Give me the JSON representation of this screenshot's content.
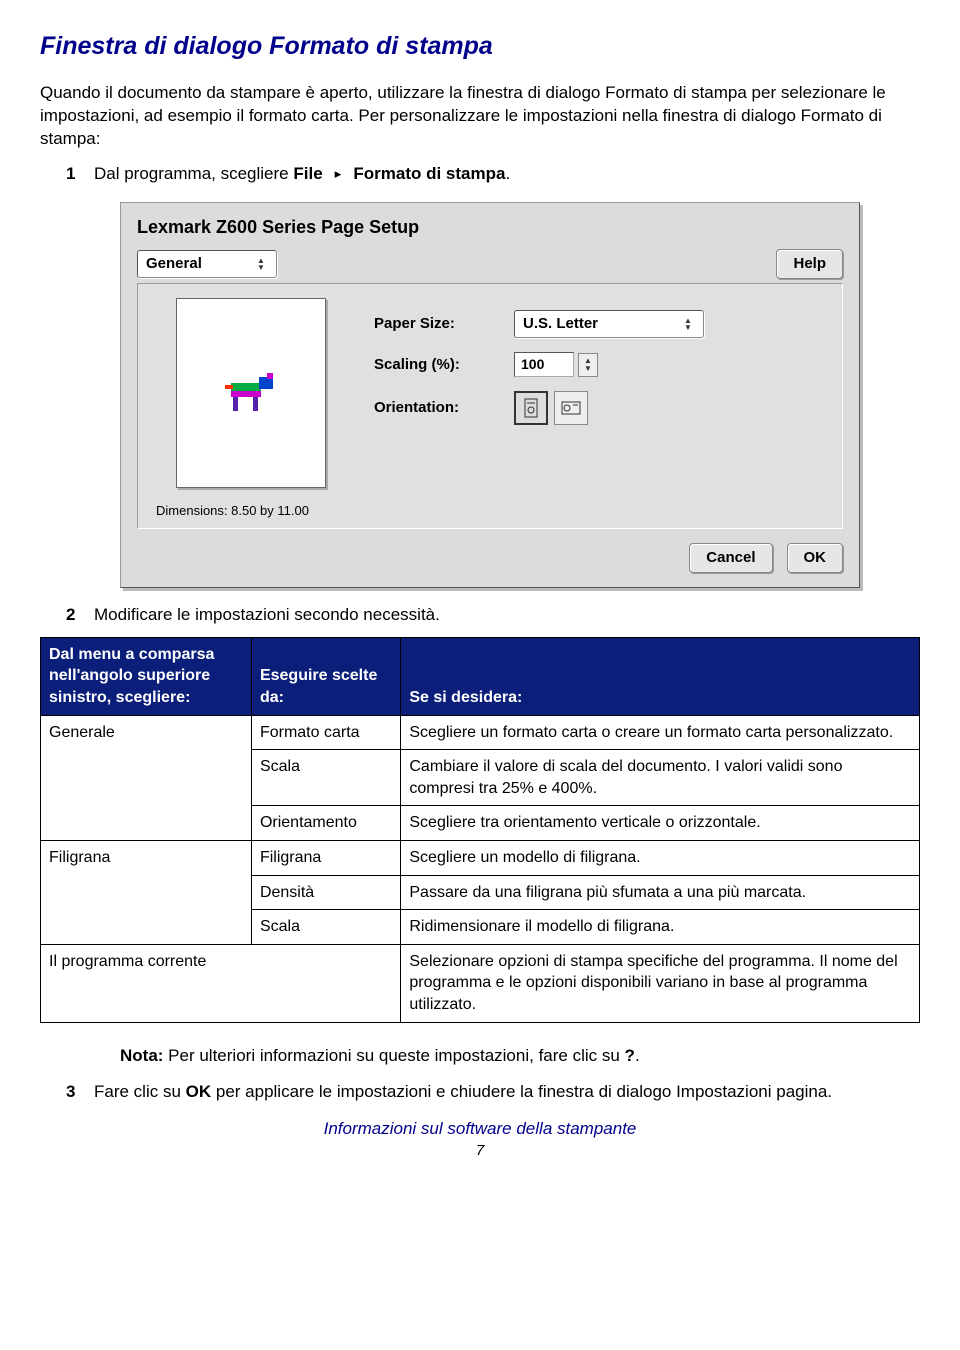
{
  "heading": "Finestra di dialogo Formato di stampa",
  "intro": "Quando il documento da stampare è aperto, utilizzare la finestra di dialogo Formato di stampa per selezionare le impostazioni, ad esempio il formato carta. Per personalizzare le impostazioni nella finestra di dialogo Formato di stampa:",
  "steps": {
    "s1_num": "1",
    "s1_pre": "Dal programma, scegliere ",
    "s1_b1": "File",
    "s1_arrow": " ▸ ",
    "s1_b2": "Formato di stampa",
    "s1_suffix": ".",
    "s2_num": "2",
    "s2_text": "Modificare le impostazioni secondo necessità.",
    "s3_num": "3",
    "s3_pre": "Fare clic su ",
    "s3_b1": "OK",
    "s3_suffix": " per applicare le impostazioni e chiudere la finestra di dialogo Impostazioni pagina."
  },
  "dialog": {
    "title": "Lexmark Z600 Series Page Setup",
    "general": "General",
    "help": "Help",
    "paper_size_label": "Paper Size:",
    "paper_size_value": "U.S. Letter",
    "scaling_label": "Scaling (%):",
    "scaling_value": "100",
    "orientation_label": "Orientation:",
    "dimensions": "Dimensions: 8.50 by 11.00",
    "cancel": "Cancel",
    "ok": "OK"
  },
  "table": {
    "h1": "Dal menu a comparsa nell'angolo superiore sinistro, scegliere:",
    "h2": "Eseguire scelte da:",
    "h3": "Se si desidera:",
    "r1c1": "Generale",
    "r1c2": "Formato carta",
    "r1c3": "Scegliere un formato carta o creare un formato carta personalizzato.",
    "r2c2": "Scala",
    "r2c3": "Cambiare il valore di scala del documento. I valori validi sono compresi tra 25% e 400%.",
    "r3c2": "Orientamento",
    "r3c3": "Scegliere tra orientamento verticale o orizzontale.",
    "r4c1": "Filigrana",
    "r4c2": "Filigrana",
    "r4c3": "Scegliere un modello di filigrana.",
    "r5c2": "Densità",
    "r5c3": "Passare da una filigrana più sfumata a una più marcata.",
    "r6c2": "Scala",
    "r6c3": "Ridimensionare il modello di filigrana.",
    "r7c1": "Il programma corrente",
    "r7c3": "Selezionare opzioni di stampa specifiche del programma. Il nome del programma e le opzioni disponibili variano in base al programma utilizzato."
  },
  "note": {
    "label": "Nota:",
    "body": " Per ulteriori informazioni su queste impostazioni, fare clic su ",
    "q": "?",
    "dot": "."
  },
  "footer": "Informazioni sul software della stampante",
  "page": "7"
}
